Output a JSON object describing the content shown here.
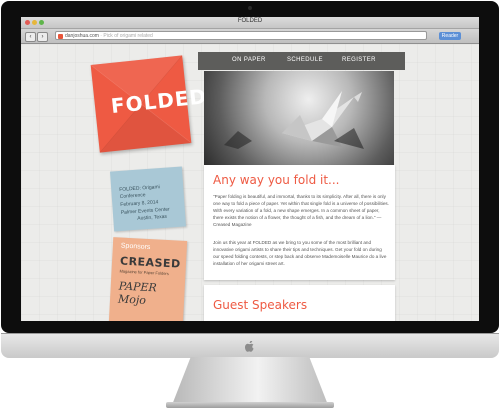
{
  "browser": {
    "window_title": "FOLDED",
    "url": "danjoshua.com",
    "url_tail": " · Pick of origami related",
    "reader_label": "Reader",
    "back_glyph": "‹",
    "forward_glyph": "›"
  },
  "site": {
    "logo": "FOLDED",
    "nav": [
      "ON PAPER",
      "SCHEDULE",
      "REGISTER"
    ],
    "event_info": [
      "FOLDED: Origami",
      "Conference",
      "February 8, 2014",
      "Palmer Events Center",
      "Austin, Texas"
    ],
    "sponsors": {
      "heading": "Sponsors",
      "creased": "CREASED",
      "creased_tagline": "Magazine for Paper Folders",
      "paper_mojo": "PAPER Mojo"
    },
    "article": {
      "title": "Any way you fold it...",
      "paragraph1": "\"Paper folding is beautiful, and immortal, thanks to its simplicity. After all, there is only one way to fold a piece of paper. Yet within that single fold is a universe of possibilities. With every variation of a fold, a new shape emerges. In a common sheet of paper, there exists the notion of a flower, the thought of a fish, and the dream of a lion.\" —Creased Magazine",
      "paragraph2": "Join us this year at FOLDED as we bring to you some of the most brilliant and innovative origami artists to share their tips and techniques. Get your fold on during our speed folding contests, or step back and observe Mademoiselle Maurice do a live installation of her origami street art."
    },
    "speakers_title": "Guest Speakers"
  },
  "colors": {
    "accent": "#ee5a43",
    "nav_bg": "#5d5d5b",
    "info_card": "#a9c8d6",
    "sponsor_card": "#f0b08c"
  },
  "icons": [
    "camera-icon",
    "favicon-icon",
    "back-icon",
    "forward-icon",
    "apple-logo-icon",
    "origami-crane-icon"
  ]
}
